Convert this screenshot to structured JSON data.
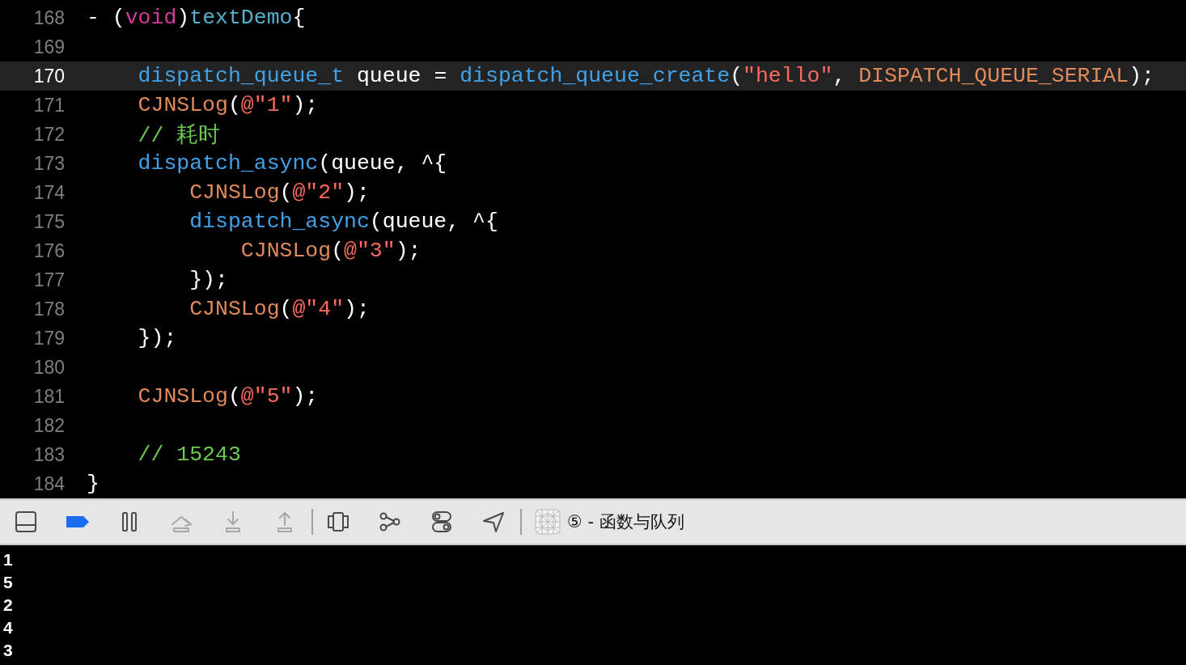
{
  "editor": {
    "lines": [
      {
        "number": "168",
        "selected": false,
        "tokens": [
          {
            "text": "- (",
            "kind": "plain"
          },
          {
            "text": "void",
            "kind": "keyword"
          },
          {
            "text": ")",
            "kind": "plain"
          },
          {
            "text": "textDemo",
            "kind": "method"
          },
          {
            "text": "{",
            "kind": "plain"
          }
        ],
        "children": [
          {
            "number": "169",
            "selected": false
          },
          {
            "number": "170",
            "selected": true,
            "tokens": [
              {
                "text": "dispatch_queue_t",
                "kind": "function"
              },
              {
                "text": " queue = ",
                "kind": "plain"
              },
              {
                "text": "dispatch_queue_create",
                "kind": "function"
              },
              {
                "text": "(",
                "kind": "plain"
              },
              {
                "text": "\"hello\"",
                "kind": "string"
              },
              {
                "text": ", ",
                "kind": "plain"
              },
              {
                "text": "DISPATCH_QUEUE_SERIAL",
                "kind": "macro"
              },
              {
                "text": ");",
                "kind": "plain"
              }
            ]
          },
          {
            "number": "171",
            "selected": false,
            "tokens": [
              {
                "text": "CJNSLog",
                "kind": "macro"
              },
              {
                "text": "(",
                "kind": "plain"
              },
              {
                "text": "@\"1\"",
                "kind": "string"
              },
              {
                "text": ");",
                "kind": "plain"
              }
            ]
          },
          {
            "number": "172",
            "selected": false,
            "tokens": [
              {
                "text": "// 耗时",
                "kind": "comment"
              }
            ]
          },
          {
            "number": "173",
            "selected": false,
            "tokens": [
              {
                "text": "dispatch_async",
                "kind": "function"
              },
              {
                "text": "(queue, ^{",
                "kind": "plain"
              }
            ],
            "children": [
              {
                "number": "174",
                "selected": false,
                "tokens": [
                  {
                    "text": "CJNSLog",
                    "kind": "macro"
                  },
                  {
                    "text": "(",
                    "kind": "plain"
                  },
                  {
                    "text": "@\"2\"",
                    "kind": "string"
                  },
                  {
                    "text": ");",
                    "kind": "plain"
                  }
                ]
              },
              {
                "number": "175",
                "selected": false,
                "tokens": [
                  {
                    "text": "dispatch_async",
                    "kind": "function"
                  },
                  {
                    "text": "(queue, ^{",
                    "kind": "plain"
                  }
                ],
                "children": [
                  {
                    "number": "176",
                    "selected": false,
                    "tokens": [
                      {
                        "text": "CJNSLog",
                        "kind": "macro"
                      },
                      {
                        "text": "(",
                        "kind": "plain"
                      },
                      {
                        "text": "@\"3\"",
                        "kind": "string"
                      },
                      {
                        "text": ");",
                        "kind": "plain"
                      }
                    ]
                  }
                ]
              },
              {
                "number": "177",
                "selected": false,
                "tokens": [
                  {
                    "text": "});",
                    "kind": "plain"
                  }
                ]
              },
              {
                "number": "178",
                "selected": false,
                "tokens": [
                  {
                    "text": "CJNSLog",
                    "kind": "macro"
                  },
                  {
                    "text": "(",
                    "kind": "plain"
                  },
                  {
                    "text": "@\"4\"",
                    "kind": "string"
                  },
                  {
                    "text": ");",
                    "kind": "plain"
                  }
                ]
              }
            ]
          },
          {
            "number": "179",
            "selected": false,
            "tokens": [
              {
                "text": "});",
                "kind": "plain"
              }
            ]
          },
          {
            "number": "180",
            "selected": false
          },
          {
            "number": "181",
            "selected": false,
            "tokens": [
              {
                "text": "CJNSLog",
                "kind": "macro"
              },
              {
                "text": "(",
                "kind": "plain"
              },
              {
                "text": "@\"5\"",
                "kind": "string"
              },
              {
                "text": ");",
                "kind": "plain"
              }
            ]
          },
          {
            "number": "182",
            "selected": false
          },
          {
            "number": "183",
            "selected": false,
            "tokens": [
              {
                "text": "// 15243",
                "kind": "comment"
              }
            ]
          }
        ]
      },
      {
        "number": "184",
        "selected": false,
        "tokens": [
          {
            "text": "}",
            "kind": "plain"
          }
        ]
      }
    ]
  },
  "debug_bar": {
    "buttons": [
      {
        "kind": "panel",
        "on": false,
        "disabled": false
      },
      {
        "kind": "breakpoints",
        "on": true,
        "disabled": false
      },
      {
        "kind": "pause",
        "on": false,
        "disabled": false
      },
      {
        "kind": "step-over",
        "on": false,
        "disabled": true
      },
      {
        "kind": "step-into",
        "on": false,
        "disabled": true
      },
      {
        "kind": "step-out",
        "on": false,
        "disabled": true
      },
      {
        "kind": "view-hierarchy",
        "on": false,
        "disabled": false
      },
      {
        "kind": "memory-graph",
        "on": false,
        "disabled": false
      },
      {
        "kind": "environment",
        "on": false,
        "disabled": false
      },
      {
        "kind": "location",
        "on": false,
        "disabled": false
      }
    ],
    "target": "⑤ - 函数与队列"
  },
  "console": {
    "lines": [
      "1",
      "5",
      "2",
      "4",
      "3"
    ]
  }
}
